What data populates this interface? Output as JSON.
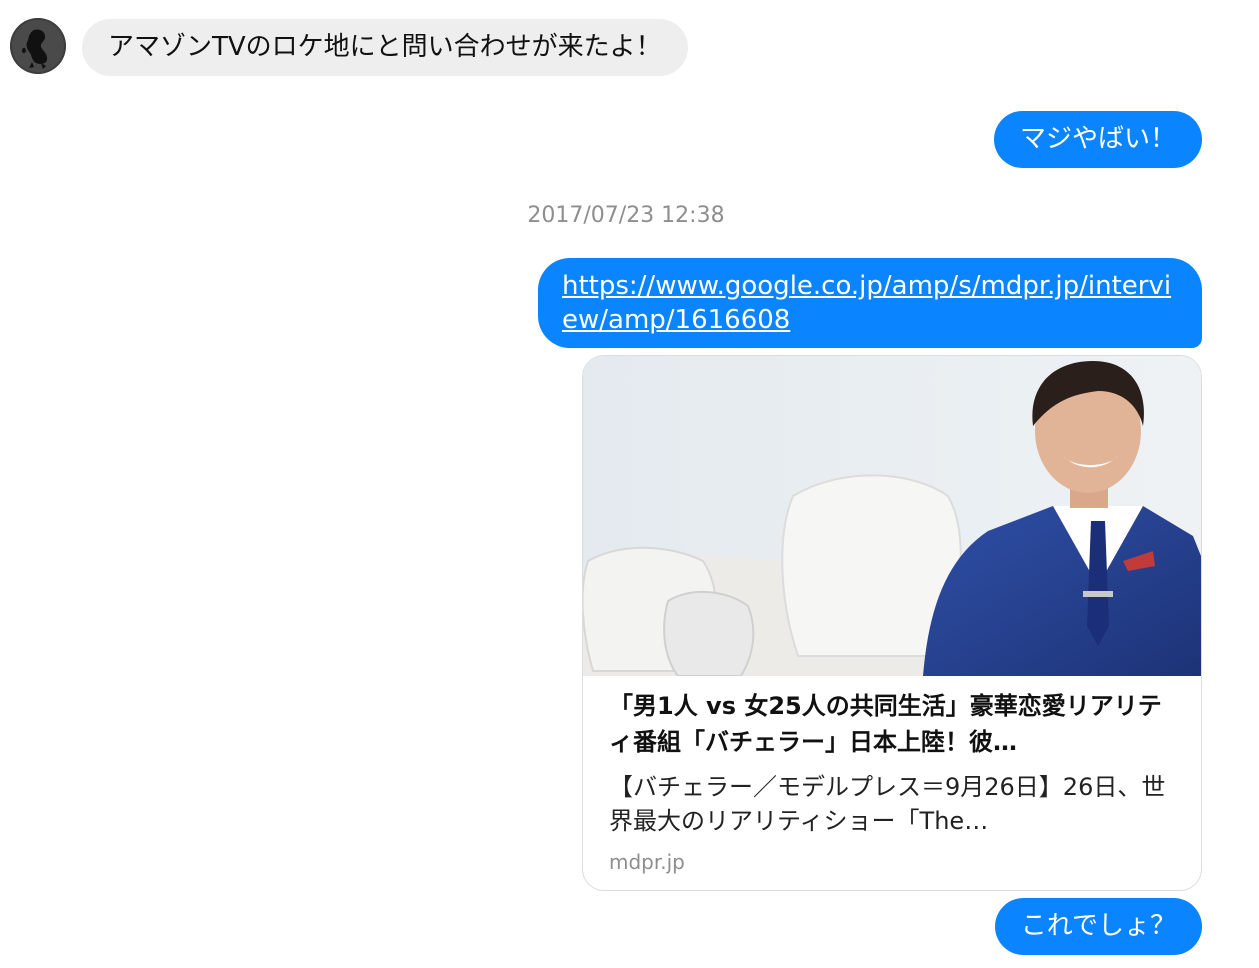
{
  "conversation": {
    "incoming_messages": [
      {
        "text": "アマゾンTVのロケ地にと問い合わせが来たよ！"
      }
    ],
    "outgoing_1": {
      "text": "マジやばい！"
    },
    "timestamp": "2017/07/23 12:38",
    "outgoing_link": {
      "url": "https://www.google.co.jp/amp/s/mdpr.jp/interview/amp/1616608",
      "text": "https://www.google.co.jp/amp/s/mdpr.jp/interview/amp/1616608"
    },
    "link_preview": {
      "title": "「男1人 vs 女25人の共同生活」豪華恋愛リアリティ番組「バチェラー」日本上陸！彼…",
      "description": "【バチェラー／モデルプレス＝9月26日】26日、世界最大のリアリティショー「The…",
      "domain": "mdpr.jp"
    },
    "outgoing_2": {
      "text": "これでしょ？"
    }
  },
  "colors": {
    "outgoing_bubble": "#0a84ff",
    "incoming_bubble": "#eeeeee",
    "timestamp": "#8e8e8e"
  }
}
